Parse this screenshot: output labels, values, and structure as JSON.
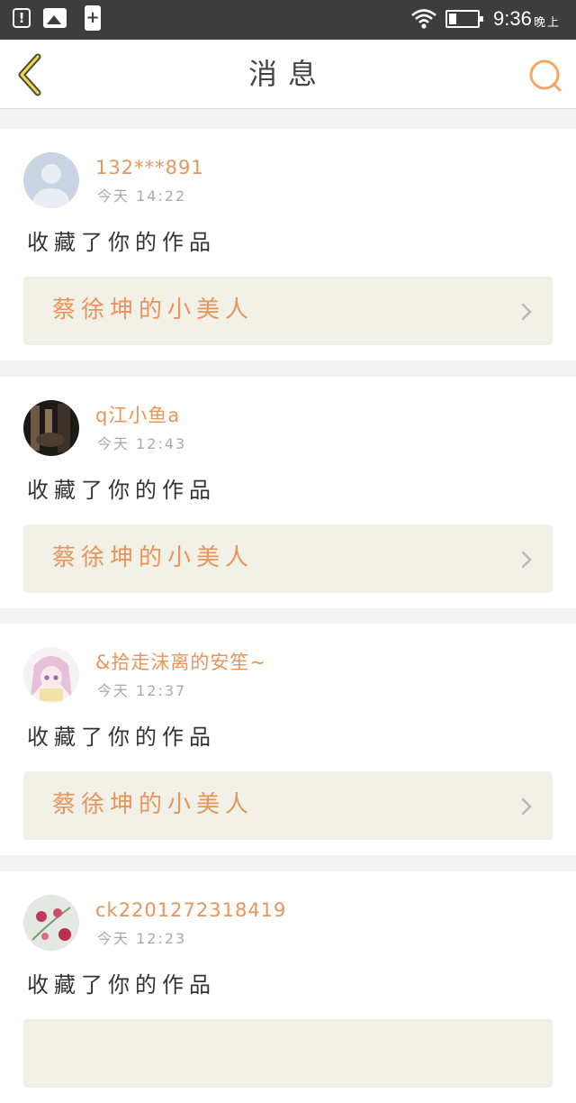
{
  "status_bar": {
    "time": "9:36",
    "ampm": "晚上",
    "icons": [
      "alert-icon",
      "image-icon",
      "battery-plus-icon",
      "wifi-icon",
      "battery-icon"
    ]
  },
  "header": {
    "title": "消息",
    "back_icon": "chevron-left-icon",
    "search_icon": "search-icon",
    "accent_color": "#e8945a"
  },
  "messages": [
    {
      "username": "132***891",
      "time": "今天 14:22",
      "action": "收藏了你的作品",
      "work_title": "蔡徐坤的小美人"
    },
    {
      "username": "q江小鱼a",
      "time": "今天 12:43",
      "action": "收藏了你的作品",
      "work_title": "蔡徐坤的小美人"
    },
    {
      "username": "&拾走沫离的安笙~",
      "time": "今天 12:37",
      "action": "收藏了你的作品",
      "work_title": "蔡徐坤的小美人"
    },
    {
      "username": "ck2201272318419",
      "time": "今天 12:23",
      "action": "收藏了你的作品",
      "work_title": ""
    }
  ]
}
